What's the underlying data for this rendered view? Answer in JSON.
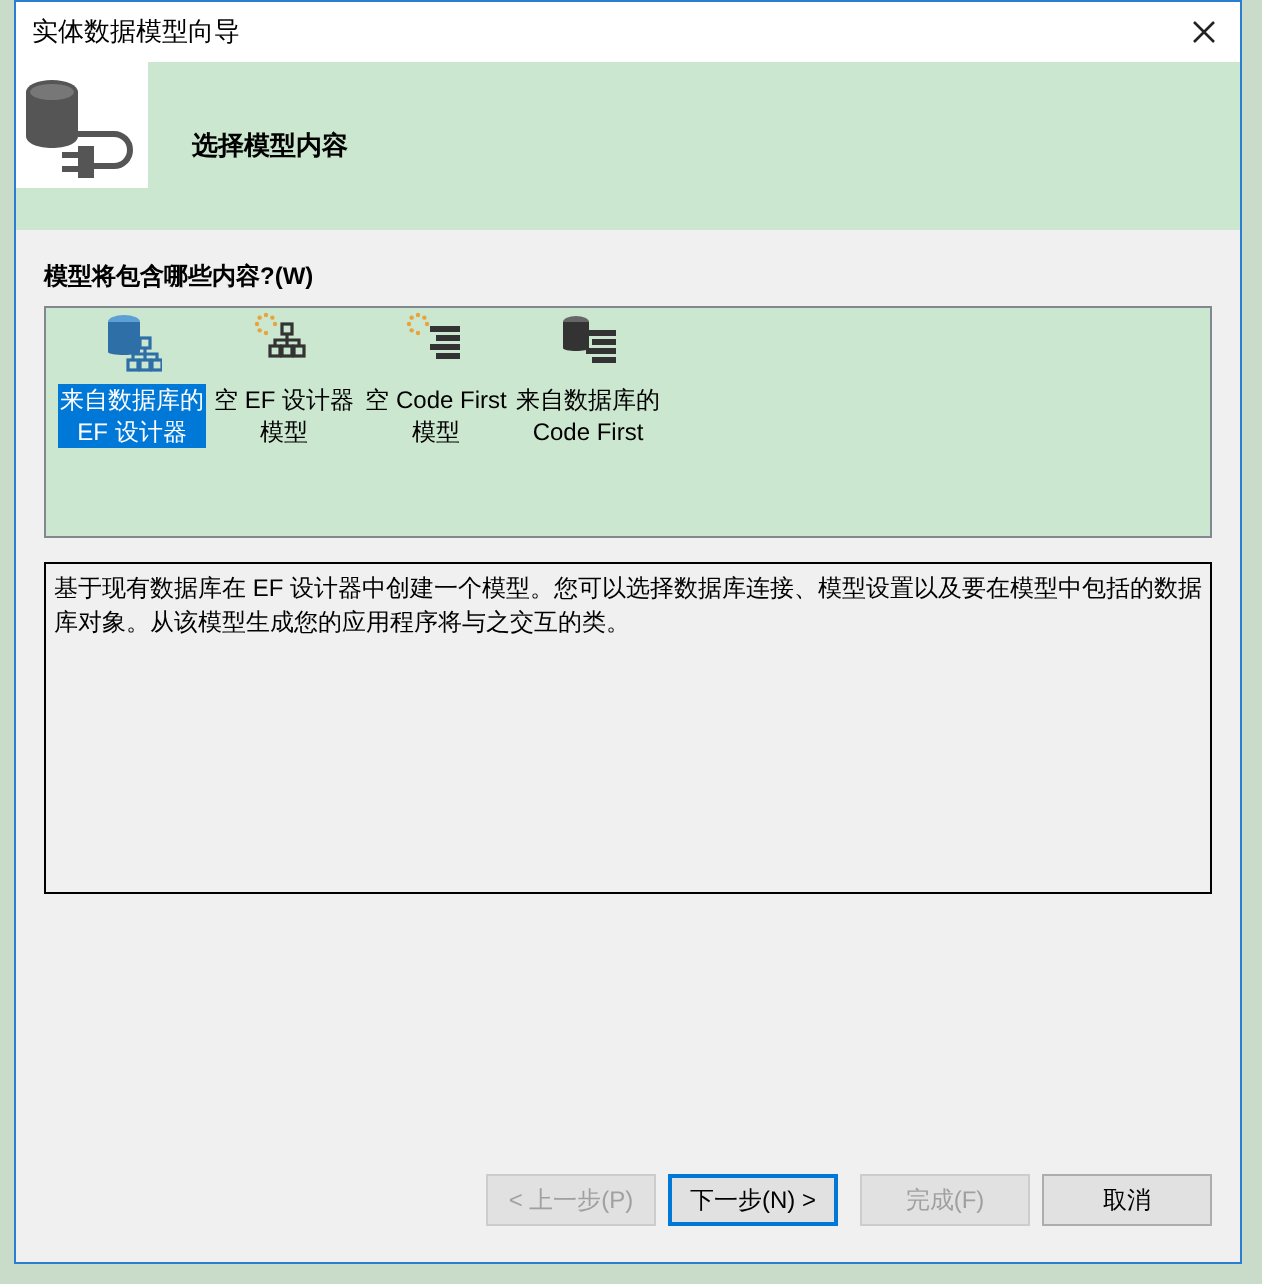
{
  "window": {
    "title": "实体数据模型向导"
  },
  "header": {
    "title": "选择模型内容"
  },
  "prompt": "模型将包含哪些内容?(W)",
  "options": [
    {
      "label": "来自数据库的 EF 设计器",
      "kind": "dbdesigner",
      "selected": true
    },
    {
      "label": "空 EF 设计器模型",
      "kind": "designer",
      "selected": false
    },
    {
      "label": "空 Code First 模型",
      "kind": "code",
      "selected": false
    },
    {
      "label": "来自数据库的 Code First",
      "kind": "dbcode",
      "selected": false
    }
  ],
  "description": "基于现有数据库在 EF 设计器中创建一个模型。您可以选择数据库连接、模型设置以及要在模型中包括的数据库对象。从该模型生成您的应用程序将与之交互的类。",
  "buttons": [
    {
      "label": "< 上一步(P)",
      "disabled": true,
      "default": false
    },
    {
      "label": "下一步(N) >",
      "disabled": false,
      "default": true
    },
    {
      "label": "完成(F)",
      "disabled": true,
      "default": false
    },
    {
      "label": "取消",
      "disabled": false,
      "default": false
    }
  ]
}
